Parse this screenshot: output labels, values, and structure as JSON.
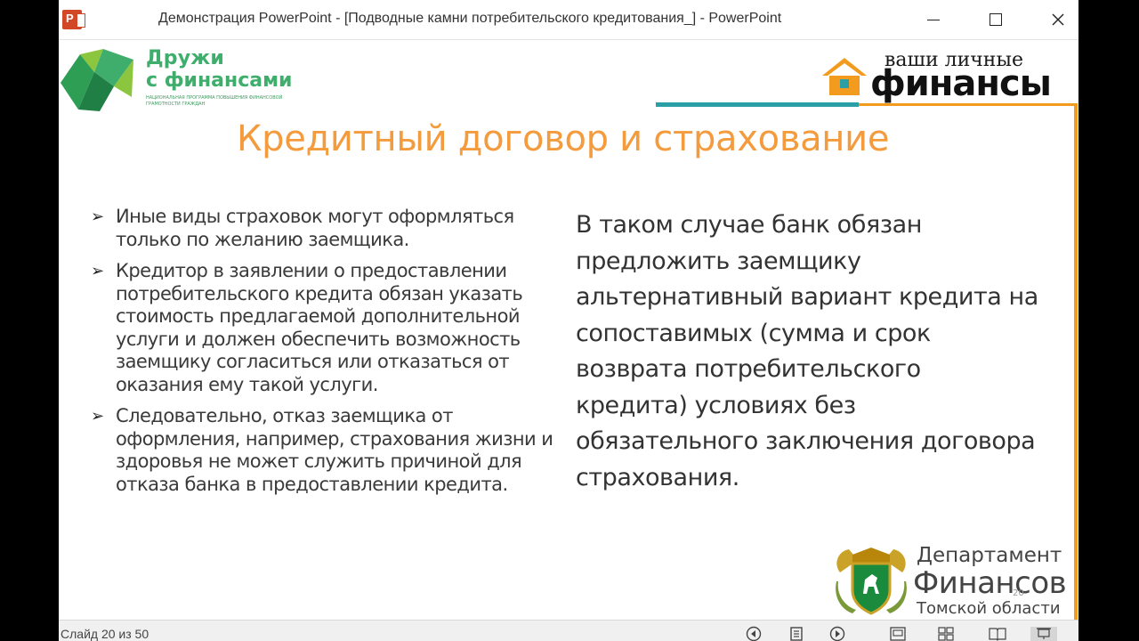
{
  "window": {
    "title": "Демонстрация PowerPoint - [Подводные камни потребительского кредитования_] - PowerPoint",
    "app_icon_letter": "P",
    "min_label": "minimize",
    "max_label": "maximize",
    "close_label": "close"
  },
  "logos": {
    "left_line1": "Дружи",
    "left_line2": "с финансами",
    "left_small": "национальная программа повышения финансовой грамотности граждан",
    "right_top": "ваши личные",
    "right_main": "финансы"
  },
  "slide": {
    "title": "Кредитный договор и страхование",
    "bullets": [
      "Иные виды страховок могут оформляться только по желанию заемщика.",
      "Кредитор в заявлении о предоставлении потребительского кредита обязан указать стоимость предлагаемой дополнительной услуги и должен обеспечить возможность заемщику согласиться или отказаться от оказания ему такой услуги.",
      "Следовательно, отказ заемщика от оформления, например, страхования жизни и здоровья не может служить причиной для отказа банка в предоставлении кредита."
    ],
    "bullet_symbol": "➢",
    "right_text": "В таком случае банк обязан предложить заемщику альтернативный вариант кредита на сопоставимых (сумма и срок возврата потребительского кредита) условиях без обязательного заключения договора страхования.",
    "dept_line1": "Департамент",
    "dept_line2": "Финансов",
    "dept_line3": "Томской области",
    "slide_number": "20"
  },
  "status": {
    "slide_counter": "Слайд 20 из 50"
  },
  "colors": {
    "title_orange": "#f39b3d",
    "teal": "#2a9fa5",
    "green": "#3fae6c"
  },
  "icons": {
    "prev": "previous-slide-icon",
    "menu": "slide-menu-icon",
    "next": "next-slide-icon",
    "normal": "normal-view-icon",
    "sorter": "slide-sorter-icon",
    "reading": "reading-view-icon",
    "show": "slide-show-icon"
  }
}
